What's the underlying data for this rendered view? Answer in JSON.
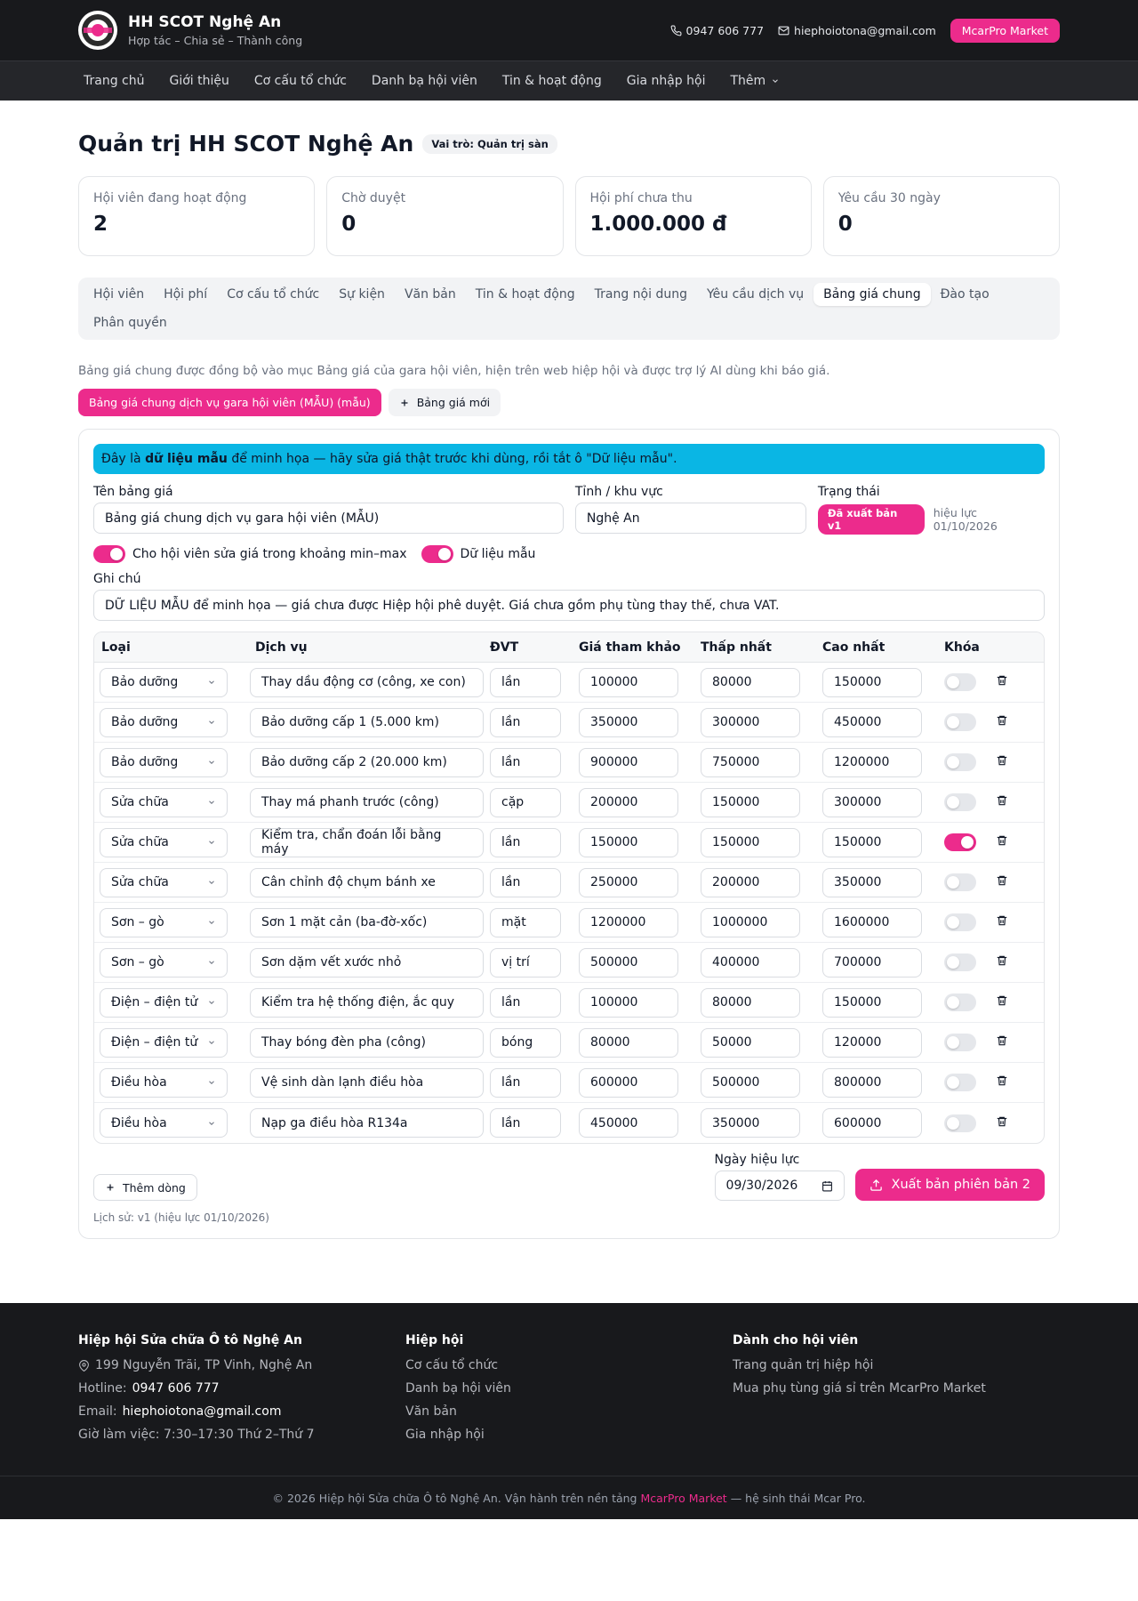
{
  "header": {
    "title": "HH SCOT Nghệ An",
    "subtitle": "Hợp tác – Chia sẻ – Thành công",
    "phone": "0947 606 777",
    "email": "hiephoiotona@gmail.com",
    "market_button": "McarPro Market"
  },
  "nav": [
    "Trang chủ",
    "Giới thiệu",
    "Cơ cấu tổ chức",
    "Danh bạ hội viên",
    "Tin & hoạt động",
    "Gia nhập hội",
    "Thêm"
  ],
  "page": {
    "title": "Quản trị HH SCOT Nghệ An",
    "role_badge": "Vai trò: Quản trị sàn"
  },
  "stats": [
    {
      "label": "Hội viên đang hoạt động",
      "value": "2"
    },
    {
      "label": "Chờ duyệt",
      "value": "0"
    },
    {
      "label": "Hội phí chưa thu",
      "value": "1.000.000 đ"
    },
    {
      "label": "Yêu cầu 30 ngày",
      "value": "0"
    }
  ],
  "tabs": [
    "Hội viên",
    "Hội phí",
    "Cơ cấu tổ chức",
    "Sự kiện",
    "Văn bản",
    "Tin & hoạt động",
    "Trang nội dung",
    "Yêu cầu dịch vụ",
    "Bảng giá chung",
    "Đào tạo",
    "Phân quyền"
  ],
  "active_tab": "Bảng giá chung",
  "description": "Bảng giá chung được đồng bộ vào mục Bảng giá của gara hội viên, hiện trên web hiệp hội và được trợ lý AI dùng khi báo giá.",
  "price_lists": {
    "active": "Bảng giá chung dịch vụ gara hội viên (MẪU) (mẫu)",
    "new_button": "Bảng giá mới"
  },
  "editor": {
    "banner_pre": "Đây là ",
    "banner_bold": "dữ liệu mẫu",
    "banner_post": " để minh họa — hãy sửa giá thật trước khi dùng, rồi tắt ô \"Dữ liệu mẫu\".",
    "name_label": "Tên bảng giá",
    "name_value": "Bảng giá chung dịch vụ gara hội viên (MẪU)",
    "region_label": "Tỉnh / khu vực",
    "region_value": "Nghệ An",
    "status_label": "Trạng thái",
    "status_value": "Đã xuất bản v1",
    "effective_text": "hiệu lực 01/10/2026",
    "toggle_minmax": "Cho hội viên sửa giá trong khoảng min–max",
    "toggle_minmax_on": true,
    "toggle_sample": "Dữ liệu mẫu",
    "toggle_sample_on": true,
    "note_label": "Ghi chú",
    "note_value": "DỮ LIỆU MẪU để minh họa — giá chưa được Hiệp hội phê duyệt. Giá chưa gồm phụ tùng thay thế, chưa VAT."
  },
  "table": {
    "headers": [
      "Loại",
      "Dịch vụ",
      "ĐVT",
      "Giá tham khảo",
      "Thấp nhất",
      "Cao nhất",
      "Khóa"
    ],
    "rows": [
      {
        "type": "Bảo dưỡng",
        "service": "Thay dầu động cơ (công, xe con)",
        "unit": "lần",
        "ref": "100000",
        "min": "80000",
        "max": "150000",
        "locked": false
      },
      {
        "type": "Bảo dưỡng",
        "service": "Bảo dưỡng cấp 1 (5.000 km)",
        "unit": "lần",
        "ref": "350000",
        "min": "300000",
        "max": "450000",
        "locked": false
      },
      {
        "type": "Bảo dưỡng",
        "service": "Bảo dưỡng cấp 2 (20.000 km)",
        "unit": "lần",
        "ref": "900000",
        "min": "750000",
        "max": "1200000",
        "locked": false
      },
      {
        "type": "Sửa chữa",
        "service": "Thay má phanh trước (công)",
        "unit": "cặp",
        "ref": "200000",
        "min": "150000",
        "max": "300000",
        "locked": false
      },
      {
        "type": "Sửa chữa",
        "service": "Kiểm tra, chẩn đoán lỗi bằng máy",
        "unit": "lần",
        "ref": "150000",
        "min": "150000",
        "max": "150000",
        "locked": true
      },
      {
        "type": "Sửa chữa",
        "service": "Cân chỉnh độ chụm bánh xe",
        "unit": "lần",
        "ref": "250000",
        "min": "200000",
        "max": "350000",
        "locked": false
      },
      {
        "type": "Sơn – gò",
        "service": "Sơn 1 mặt cản (ba-đờ-xốc)",
        "unit": "mặt",
        "ref": "1200000",
        "min": "1000000",
        "max": "1600000",
        "locked": false
      },
      {
        "type": "Sơn – gò",
        "service": "Sơn dặm vết xước nhỏ",
        "unit": "vị trí",
        "ref": "500000",
        "min": "400000",
        "max": "700000",
        "locked": false
      },
      {
        "type": "Điện – điện tử",
        "service": "Kiểm tra hệ thống điện, ắc quy",
        "unit": "lần",
        "ref": "100000",
        "min": "80000",
        "max": "150000",
        "locked": false
      },
      {
        "type": "Điện – điện tử",
        "service": "Thay bóng đèn pha (công)",
        "unit": "bóng",
        "ref": "80000",
        "min": "50000",
        "max": "120000",
        "locked": false
      },
      {
        "type": "Điều hòa",
        "service": "Vệ sinh dàn lạnh điều hòa",
        "unit": "lần",
        "ref": "600000",
        "min": "500000",
        "max": "800000",
        "locked": false
      },
      {
        "type": "Điều hòa",
        "service": "Nạp ga điều hòa R134a",
        "unit": "lần",
        "ref": "450000",
        "min": "350000",
        "max": "600000",
        "locked": false
      }
    ]
  },
  "actions": {
    "add_row": "Thêm dòng",
    "date_label": "Ngày hiệu lực",
    "date_value": "09/30/2026",
    "publish": "Xuất bản phiên bản 2",
    "history": "Lịch sử: v1 (hiệu lực 01/10/2026)"
  },
  "footer": {
    "col1_title": "Hiệp hội Sửa chữa Ô tô Nghệ An",
    "address": "199 Nguyễn Trãi, TP Vinh, Nghệ An",
    "hotline_label": "Hotline: ",
    "hotline_value": "0947 606 777",
    "email_label": "Email: ",
    "email_value": "hiephoiotona@gmail.com",
    "hours": "Giờ làm việc: 7:30–17:30 Thứ 2–Thứ 7",
    "col2_title": "Hiệp hội",
    "col2_links": [
      "Cơ cấu tổ chức",
      "Danh bạ hội viên",
      "Văn bản",
      "Gia nhập hội"
    ],
    "col3_title": "Dành cho hội viên",
    "col3_links": [
      "Trang quản trị hiệp hội",
      "Mua phụ tùng giá sỉ trên McarPro Market"
    ],
    "copyright_pre": "© 2026 Hiệp hội Sửa chữa Ô tô Nghệ An. Vận hành trên nền tảng ",
    "copyright_link": "McarPro Market",
    "copyright_post": " — hệ sinh thái Mcar Pro."
  },
  "colors": {
    "accent": "#ec2b8c",
    "banner": "#0ab6e4",
    "header_bg": "#18191c"
  }
}
